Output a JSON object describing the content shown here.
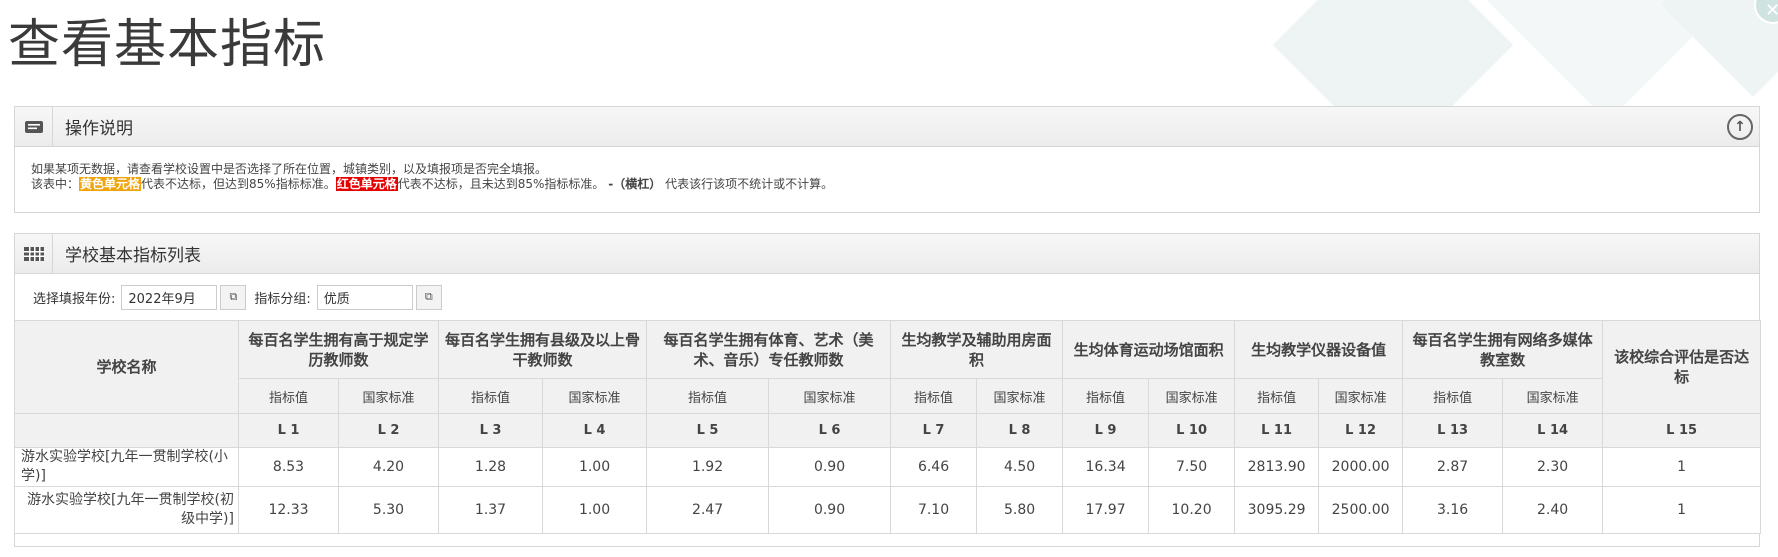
{
  "page": {
    "title": "查看基本指标"
  },
  "help_panel": {
    "title": "操作说明",
    "line1": "如果某项无数据，请查看学校设置中是否选择了所在位置，城镇类别，以及填报项是否完全填报。",
    "line2_prefix": "该表中：",
    "yellow_label": "黄色单元格",
    "yellow_desc": "代表不达标，但达到85%指标标准。",
    "red_label": "红色单元格",
    "red_desc": "代表不达标，且未达到85%指标标准。",
    "dash_label": "-（横杠）",
    "dash_desc": "代表该行该项不统计或不计算。"
  },
  "list_panel": {
    "title": "学校基本指标列表",
    "year_label": "选择填报年份:",
    "year_value": "2022年9月",
    "group_label": "指标分组:",
    "group_value": "优质"
  },
  "table": {
    "school_header": "学校名称",
    "groups": [
      "每百名学生拥有高于规定学历教师数",
      "每百名学生拥有县级及以上骨干教师数",
      "每百名学生拥有体育、艺术（美术、音乐）专任教师数",
      "生均教学及辅助用房面积",
      "生均体育运动场馆面积",
      "生均教学仪器设备值",
      "每百名学生拥有网络多媒体教室数"
    ],
    "final_header": "该校综合评估是否达标",
    "sub_value": "指标值",
    "sub_standard": "国家标准",
    "codes": [
      "L 1",
      "L 2",
      "L 3",
      "L 4",
      "L 5",
      "L 6",
      "L 7",
      "L 8",
      "L 9",
      "L 10",
      "L 11",
      "L 12",
      "L 13",
      "L 14",
      "L 15"
    ],
    "rows": [
      {
        "name": "游水实验学校[九年一贯制学校(小学)]",
        "values": [
          "8.53",
          "4.20",
          "1.28",
          "1.00",
          "1.92",
          "0.90",
          "6.46",
          "4.50",
          "16.34",
          "7.50",
          "2813.90",
          "2000.00",
          "2.87",
          "2.30",
          "1"
        ]
      },
      {
        "name": "游水实验学校[九年一贯制学校(初级中学)]",
        "values": [
          "12.33",
          "5.30",
          "1.37",
          "1.00",
          "2.47",
          "0.90",
          "7.10",
          "5.80",
          "17.97",
          "10.20",
          "3095.29",
          "2500.00",
          "3.16",
          "2.40",
          "1"
        ]
      }
    ]
  },
  "colors": {
    "yellow": "#f0a30a",
    "red": "#e60000",
    "header_bg": "#f1f1f1"
  }
}
